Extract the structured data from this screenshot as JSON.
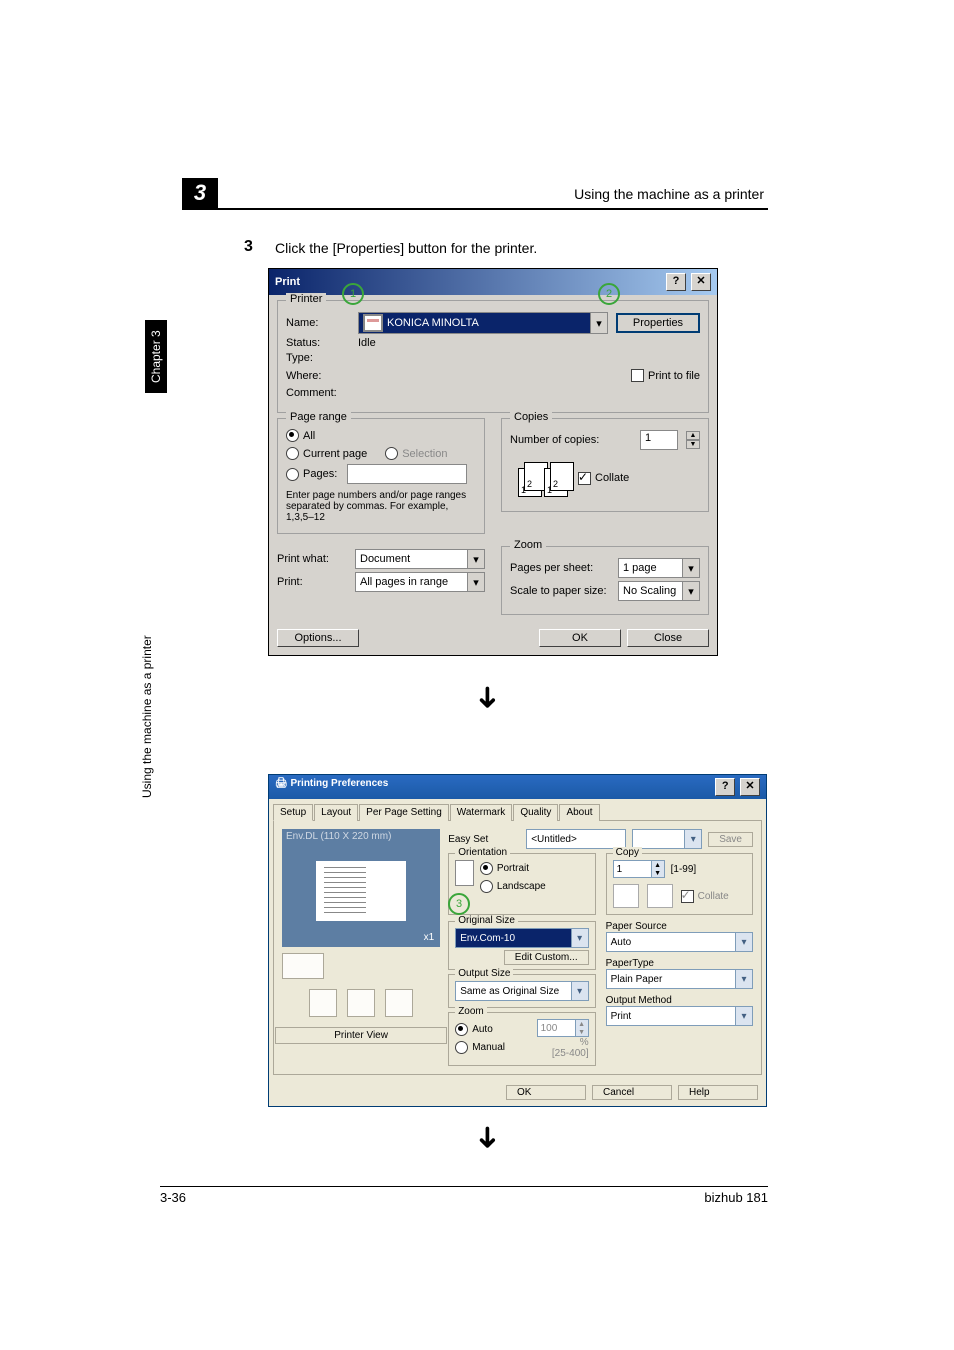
{
  "header": {
    "section": "Using the machine as a printer",
    "chapter_num": "3"
  },
  "sidebar": {
    "chapter_label": "Chapter 3",
    "side_label": "Using the machine as a printer"
  },
  "step": {
    "num": "3",
    "text": "Click the [Properties] button for the printer."
  },
  "print_dialog": {
    "title": "Print",
    "help_glyph": "?",
    "close_glyph": "✕",
    "printer_group": "Printer",
    "name_label": "Name:",
    "name_value": "KONICA MINOLTA",
    "properties_btn": "Properties",
    "status_label": "Status:",
    "status_value": "Idle",
    "type_label": "Type:",
    "where_label": "Where:",
    "comment_label": "Comment:",
    "print_to_file": "Print to file",
    "page_range_group": "Page range",
    "all": "All",
    "current_page": "Current page",
    "selection": "Selection",
    "pages": "Pages:",
    "pages_hint": "Enter page numbers and/or page ranges separated by commas.  For example, 1,3,5–12",
    "copies_group": "Copies",
    "num_copies_label": "Number of copies:",
    "num_copies_value": "1",
    "collate": "Collate",
    "zoom_group": "Zoom",
    "print_what_label": "Print what:",
    "print_what_value": "Document",
    "print_label": "Print:",
    "print_value": "All pages in range",
    "pages_per_sheet_label": "Pages per sheet:",
    "pages_per_sheet_value": "1 page",
    "scale_label": "Scale to paper size:",
    "scale_value": "No Scaling",
    "options_btn": "Options...",
    "ok": "OK",
    "close": "Close"
  },
  "prefs_dialog": {
    "title": "Printing Preferences",
    "tabs": [
      "Setup",
      "Layout",
      "Per Page Setting",
      "Watermark",
      "Quality",
      "About"
    ],
    "preview_label": "Env.DL (110 X 220 mm)",
    "x1": "x1",
    "printer_view": "Printer View",
    "easy_set_label": "Easy Set",
    "easy_set_value": "<Untitled>",
    "save": "Save",
    "orientation_group": "Orientation",
    "portrait": "Portrait",
    "landscape": "Landscape",
    "copy_group": "Copy",
    "copy_value": "1",
    "copy_range": "[1-99]",
    "collate": "Collate",
    "original_size_group": "Original Size",
    "original_size_value": "Env.Com-10",
    "edit_custom": "Edit Custom...",
    "output_size_group": "Output Size",
    "output_size_value": "Same as Original Size",
    "zoom_group": "Zoom",
    "auto": "Auto",
    "manual": "Manual",
    "zoom_value": "100",
    "zoom_percent": "%",
    "zoom_range": "[25-400]",
    "paper_source_label": "Paper Source",
    "paper_source_value": "Auto",
    "paper_type_label": "PaperType",
    "paper_type_value": "Plain Paper",
    "output_method_label": "Output Method",
    "output_method_value": "Print",
    "ok": "OK",
    "cancel": "Cancel",
    "help": "Help"
  },
  "annotations": {
    "n1": "1",
    "n2": "2",
    "n3": "3"
  },
  "footer": {
    "page": "3-36",
    "model": "bizhub 181"
  }
}
